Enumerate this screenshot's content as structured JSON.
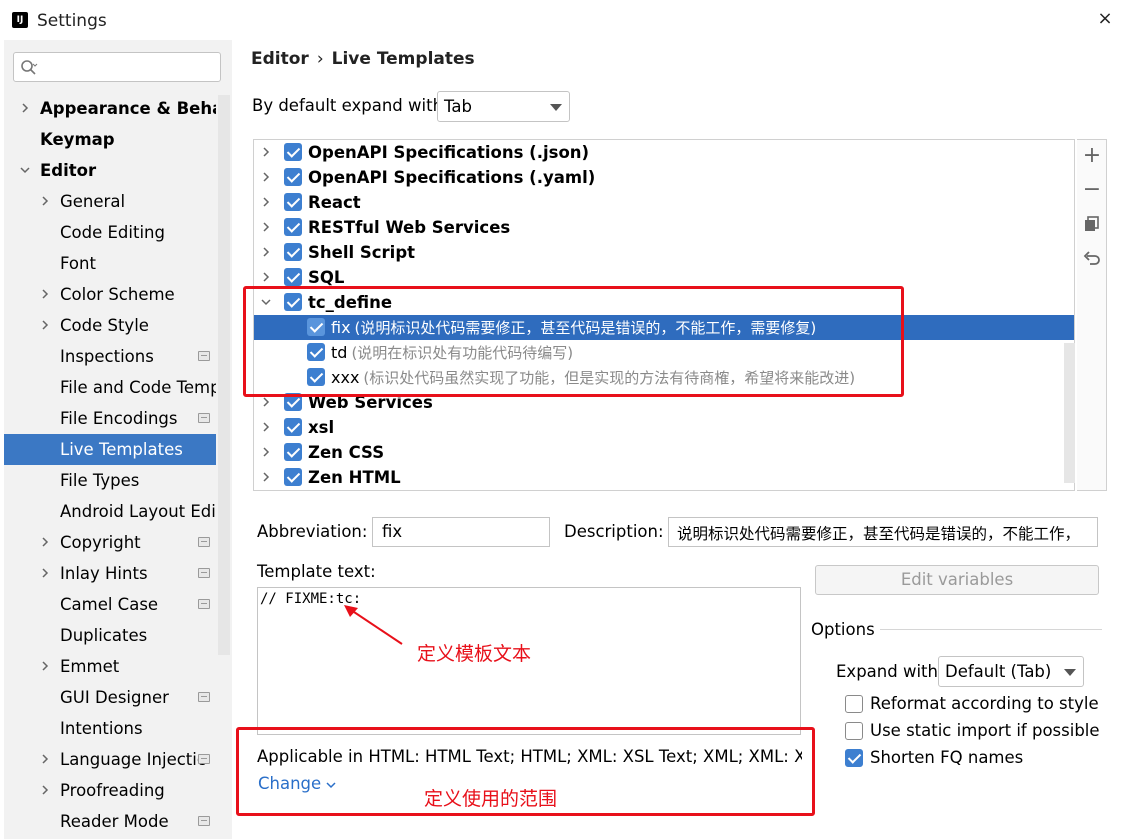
{
  "window": {
    "title": "Settings",
    "app_icon": "intellij-icon",
    "close": "×"
  },
  "sidebar": {
    "search_placeholder": "",
    "items": [
      {
        "label": "Appearance & Behav",
        "bold": true,
        "chevron": "right",
        "level": 0
      },
      {
        "label": "Keymap",
        "bold": true,
        "chevron": "",
        "level": 0
      },
      {
        "label": "Editor",
        "bold": true,
        "chevron": "down",
        "level": 0
      },
      {
        "label": "General",
        "chevron": "right",
        "level": 1
      },
      {
        "label": "Code Editing",
        "chevron": "",
        "level": 1
      },
      {
        "label": "Font",
        "chevron": "",
        "level": 1
      },
      {
        "label": "Color Scheme",
        "chevron": "right",
        "level": 1
      },
      {
        "label": "Code Style",
        "chevron": "right",
        "level": 1
      },
      {
        "label": "Inspections",
        "chevron": "",
        "level": 1,
        "badge": true
      },
      {
        "label": "File and Code Temp",
        "chevron": "",
        "level": 1
      },
      {
        "label": "File Encodings",
        "chevron": "",
        "level": 1,
        "badge": true
      },
      {
        "label": "Live Templates",
        "chevron": "",
        "level": 1,
        "selected": true
      },
      {
        "label": "File Types",
        "chevron": "",
        "level": 1
      },
      {
        "label": "Android Layout Edit",
        "chevron": "",
        "level": 1
      },
      {
        "label": "Copyright",
        "chevron": "right",
        "level": 1,
        "badge": true
      },
      {
        "label": "Inlay Hints",
        "chevron": "right",
        "level": 1,
        "badge": true
      },
      {
        "label": "Camel Case",
        "chevron": "",
        "level": 1,
        "badge": true
      },
      {
        "label": "Duplicates",
        "chevron": "",
        "level": 1
      },
      {
        "label": "Emmet",
        "chevron": "right",
        "level": 1
      },
      {
        "label": "GUI Designer",
        "chevron": "",
        "level": 1,
        "badge": true
      },
      {
        "label": "Intentions",
        "chevron": "",
        "level": 1
      },
      {
        "label": "Language Injectic",
        "chevron": "right",
        "level": 1,
        "badge": true
      },
      {
        "label": "Proofreading",
        "chevron": "right",
        "level": 1
      },
      {
        "label": "Reader Mode",
        "chevron": "",
        "level": 1,
        "badge": true
      }
    ]
  },
  "breadcrumb": {
    "parent": "Editor",
    "sep": "›",
    "current": "Live Templates"
  },
  "expand_default": {
    "label": "By default expand with",
    "value": "Tab"
  },
  "tree": {
    "rows": [
      {
        "kind": "group",
        "label": "OpenAPI Specifications (.json)",
        "chevron": "right",
        "checked": true
      },
      {
        "kind": "group",
        "label": "OpenAPI Specifications (.yaml)",
        "chevron": "right",
        "checked": true
      },
      {
        "kind": "group",
        "label": "React",
        "chevron": "right",
        "checked": true
      },
      {
        "kind": "group",
        "label": "RESTful Web Services",
        "chevron": "right",
        "checked": true
      },
      {
        "kind": "group",
        "label": "Shell Script",
        "chevron": "right",
        "checked": true
      },
      {
        "kind": "group",
        "label": "SQL",
        "chevron": "right",
        "checked": true
      },
      {
        "kind": "group",
        "label": "tc_define",
        "chevron": "down",
        "checked": true
      },
      {
        "kind": "template",
        "label": "fix",
        "desc": "(说明标识处代码需要修正，甚至代码是错误的，不能工作，需要修复)",
        "checked": true,
        "selected": true
      },
      {
        "kind": "template",
        "label": "td",
        "desc": "(说明在标识处有功能代码待编写)",
        "checked": true
      },
      {
        "kind": "template",
        "label": "xxx",
        "desc": "(标识处代码虽然实现了功能，但是实现的方法有待商榷，希望将来能改进)",
        "checked": true
      },
      {
        "kind": "group",
        "label": "Web Services",
        "chevron": "right",
        "checked": true
      },
      {
        "kind": "group",
        "label": "xsl",
        "chevron": "right",
        "checked": true
      },
      {
        "kind": "group",
        "label": "Zen CSS",
        "chevron": "right",
        "checked": true
      },
      {
        "kind": "group",
        "label": "Zen HTML",
        "chevron": "right",
        "checked": true
      }
    ]
  },
  "toolbar": {
    "add": "+",
    "remove": "−",
    "copy": "copy-icon",
    "revert": "undo-icon"
  },
  "abbreviation": {
    "label": "Abbreviation:",
    "value": "fix"
  },
  "description": {
    "label": "Description:",
    "value": "说明标识处代码需要修正，甚至代码是错误的，不能工作，"
  },
  "template_text": {
    "label": "Template text:",
    "value": "// FIXME:tc:"
  },
  "edit_variables": "Edit variables",
  "options": {
    "label": "Options",
    "expand_with_label": "Expand with",
    "expand_with_value": "Default (Tab)",
    "checks": [
      {
        "label": "Reformat according to style",
        "checked": false
      },
      {
        "label": "Use static import if possible",
        "checked": false
      },
      {
        "label": "Shorten FQ names",
        "checked": true
      }
    ]
  },
  "applicable": {
    "text": "Applicable in HTML: HTML Text; HTML; XML: XSL Text; XML; XML: XM...",
    "change": "Change"
  },
  "annotations": {
    "template_text": "定义模板文本",
    "scope": "定义使用的范围"
  },
  "colors": {
    "accent": "#3b78c4",
    "highlight": "#e8101a",
    "link": "#2a6fc9"
  }
}
